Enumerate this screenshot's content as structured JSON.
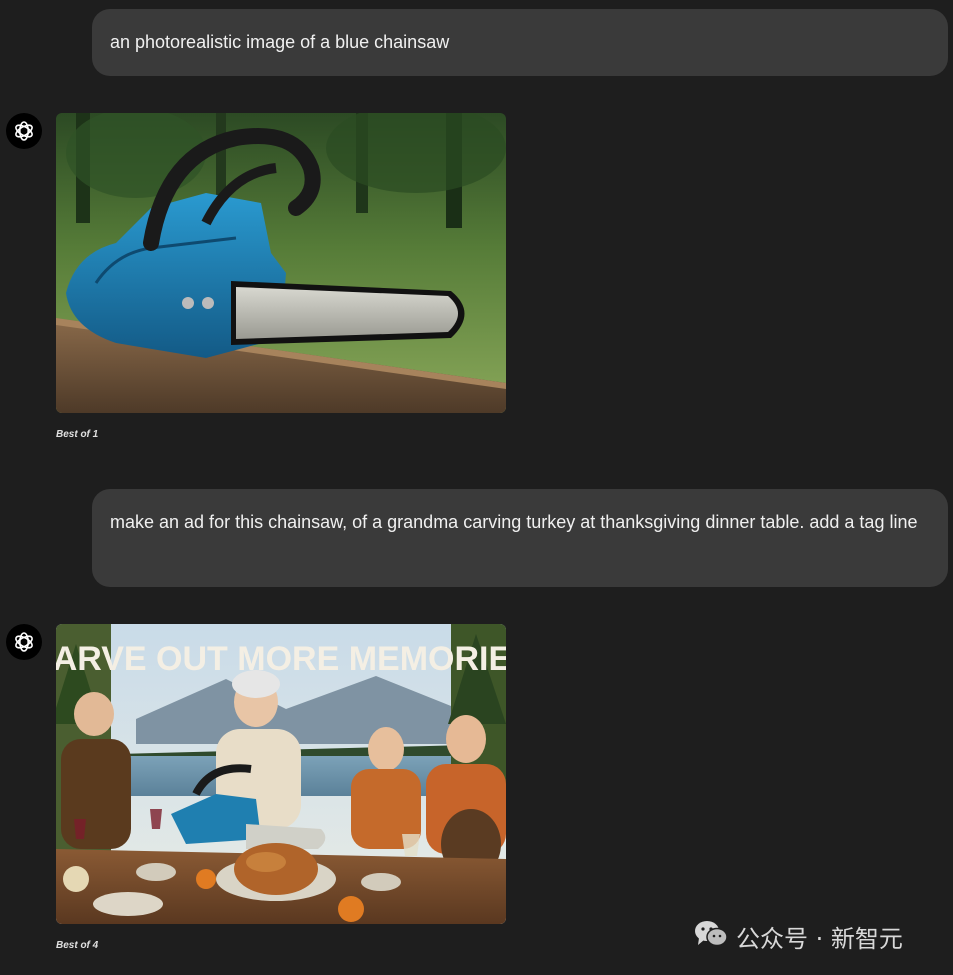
{
  "messages": [
    {
      "role": "user",
      "text": "an photorealistic image of a blue chainsaw"
    },
    {
      "role": "assistant",
      "image": "blue-chainsaw-on-wooden-bench",
      "caption": "Best of 1"
    },
    {
      "role": "user",
      "text": "make an ad for this chainsaw, of a grandma carving turkey at thanksgiving dinner table. add a tag line"
    },
    {
      "role": "assistant",
      "image": "thanksgiving-chainsaw-ad",
      "caption": "Best of 4",
      "image_text": "CARVE OUT MORE MEMORIES"
    }
  ],
  "avatar_icon": "openai-logo-icon",
  "watermark": {
    "icon": "wechat-icon",
    "text": "公众号 · 新智元"
  },
  "colors": {
    "background": "#1e1e1e",
    "user_bubble": "#3a3a3a",
    "chainsaw_blue": "#1f7fb0"
  }
}
